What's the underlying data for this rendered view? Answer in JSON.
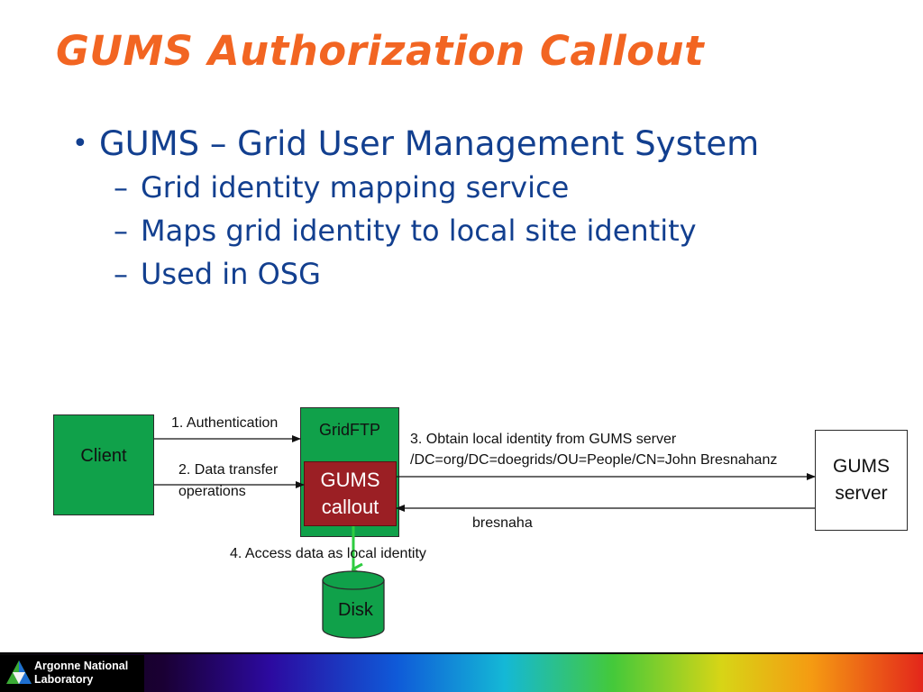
{
  "slide": {
    "title": "GUMS Authorization Callout",
    "bullet": "GUMS – Grid User Management System",
    "sub_bullets": [
      "Grid identity mapping service",
      "Maps grid identity to local site identity",
      "Used in OSG"
    ]
  },
  "diagram": {
    "client": "Client",
    "gridftp": "GridFTP",
    "gums_callout": [
      "GUMS",
      "callout"
    ],
    "gums_server": [
      "GUMS",
      "server"
    ],
    "disk": "Disk",
    "labels": {
      "authentication": "1. Authentication",
      "data_transfer": [
        "2. Data transfer",
        "operations"
      ],
      "obtain_identity": [
        "3. Obtain local identity from GUMS server",
        "/DC=org/DC=doegrids/OU=People/CN=John Bresnahanz"
      ],
      "response": "bresnaha",
      "access_data": "4. Access data as local identity"
    },
    "colors": {
      "box_green": "#10a14a",
      "callout_red": "#9b1f24",
      "title_orange": "#f26522",
      "text_blue": "#123f8f",
      "disk_arrow_green": "#2ecc40"
    }
  },
  "footer": {
    "org": [
      "Argonne National",
      "Laboratory"
    ]
  }
}
